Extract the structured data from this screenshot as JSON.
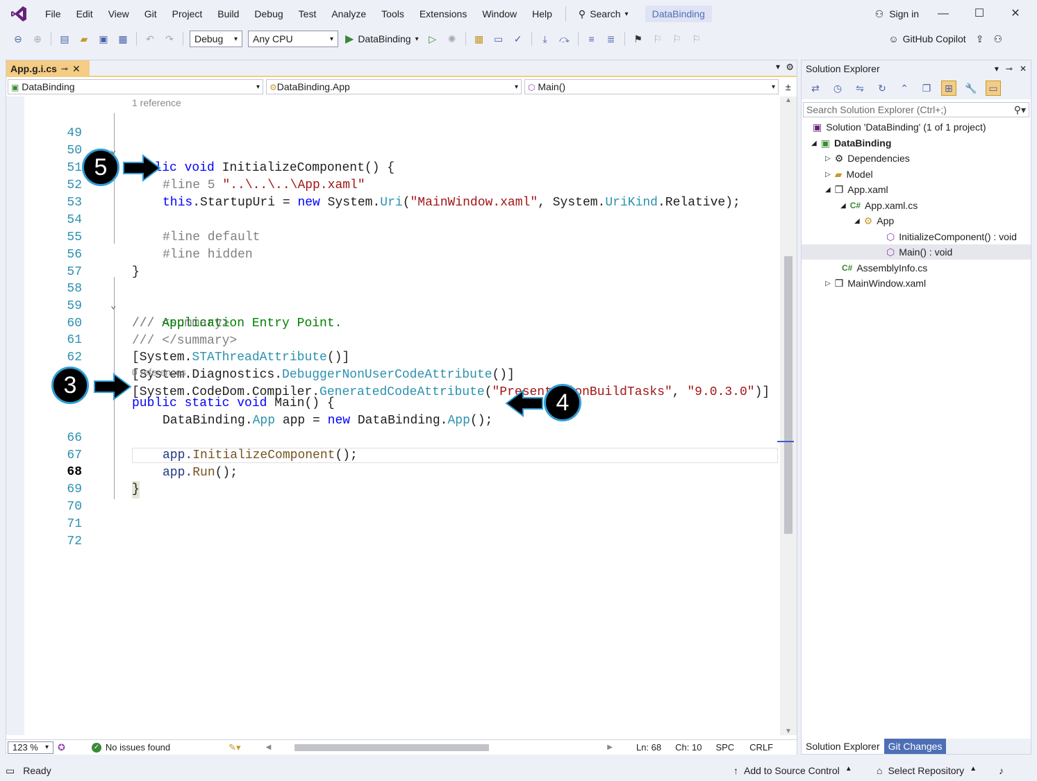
{
  "menu": {
    "items": [
      "File",
      "Edit",
      "View",
      "Git",
      "Project",
      "Build",
      "Debug",
      "Test",
      "Analyze",
      "Tools",
      "Extensions",
      "Window",
      "Help"
    ],
    "search_label": "Search",
    "project_name": "DataBinding",
    "signin_label": "Sign in"
  },
  "toolbar": {
    "config": "Debug",
    "platform": "Any CPU",
    "run_target": "DataBinding",
    "copilot_label": "GitHub Copilot"
  },
  "editor": {
    "tab_label": "App.g.i.cs",
    "nav_project": "DataBinding",
    "nav_class": "DataBinding.App",
    "nav_member": "Main()",
    "zoom": "123 %",
    "issues": "No issues found",
    "ln": "Ln: 68",
    "ch": "Ch: 10",
    "spc": "SPC",
    "eol": "CRLF"
  },
  "code": {
    "ref1": "1 reference",
    "ref0": "0 references",
    "line_numbers": [
      "49",
      "50",
      "51",
      "52",
      "53",
      "54",
      "55",
      "56",
      "57",
      "58",
      "59",
      "60",
      "61",
      "62",
      "63",
      "66",
      "67",
      "68",
      "69",
      "70",
      "71",
      "72"
    ],
    "l49": [
      "public",
      "void",
      "InitializeComponent() {"
    ],
    "l51": [
      "#line 5 ",
      "\"..\\..\\..\\App.xaml\""
    ],
    "l52": [
      "this",
      ".StartupUri = ",
      "new",
      " System.",
      "Uri",
      "(",
      "\"MainWindow.xaml\"",
      ", System.",
      "UriKind",
      ".Relative);"
    ],
    "l54": "#line default",
    "l55": "#line hidden",
    "l56": "}",
    "l58": [
      "///",
      " <summary>"
    ],
    "l59": [
      "///",
      " Application Entry Point."
    ],
    "l60": [
      "///",
      " </summary>"
    ],
    "l61": [
      "[System.",
      "STAThreadAttribute",
      "()]"
    ],
    "l62": [
      "[System.Diagnostics.",
      "DebuggerNonUserCodeAttribute",
      "()]"
    ],
    "l63": [
      "[System.CodeDom.Compiler.",
      "GeneratedCodeAttribute",
      "(",
      "\"PresentationBuildTasks\"",
      ", ",
      "\"9.0.3.0\"",
      ")]"
    ],
    "l64": [
      "public",
      "static",
      "void",
      "Main() {"
    ],
    "l65": [
      "DataBinding.",
      "App",
      " app = ",
      "new",
      " DataBinding.",
      "App",
      "();"
    ],
    "l66": [
      "app.",
      "InitializeComponent",
      "();"
    ],
    "l67": [
      "app.",
      "Run",
      "();"
    ],
    "l68": "}"
  },
  "callouts": {
    "c3": "3",
    "c4": "4",
    "c5": "5"
  },
  "solution_explorer": {
    "title": "Solution Explorer",
    "search_placeholder": "Search Solution Explorer (Ctrl+;)",
    "tree": [
      "Solution 'DataBinding' (1 of 1 project)",
      "DataBinding",
      "Dependencies",
      "Model",
      "App.xaml",
      "App.xaml.cs",
      "App",
      "InitializeComponent() : void",
      "Main() : void",
      "AssemblyInfo.cs",
      "MainWindow.xaml"
    ],
    "tab_active": "Solution Explorer",
    "tab_other": "Git Changes"
  },
  "status": {
    "ready": "Ready",
    "add_source": "Add to Source Control",
    "select_repo": "Select Repository"
  },
  "colors": {
    "accent": "#68217a",
    "tab": "#f5cc84",
    "callout_border": "#2f9ed8"
  }
}
